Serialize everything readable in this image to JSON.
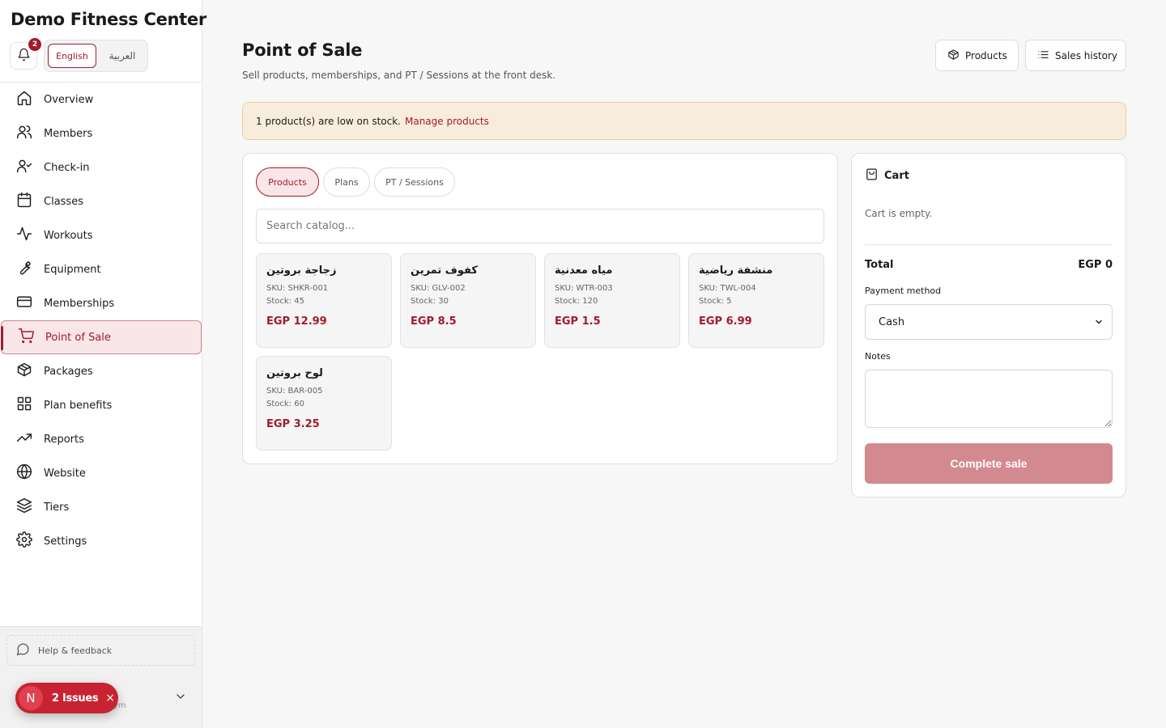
{
  "app": {
    "title": "Demo Fitness Center"
  },
  "notifications": {
    "count": "2"
  },
  "language": {
    "english": "English",
    "arabic": "العربية"
  },
  "sidebar": {
    "items": [
      {
        "label": "Overview",
        "icon": "home-icon"
      },
      {
        "label": "Members",
        "icon": "users-icon"
      },
      {
        "label": "Check-in",
        "icon": "user-check-icon"
      },
      {
        "label": "Classes",
        "icon": "calendar-icon"
      },
      {
        "label": "Workouts",
        "icon": "activity-icon"
      },
      {
        "label": "Equipment",
        "icon": "wrench-icon"
      },
      {
        "label": "Memberships",
        "icon": "credit-card-icon"
      },
      {
        "label": "Point of Sale",
        "icon": "cart-icon",
        "active": true
      },
      {
        "label": "Packages",
        "icon": "package-icon"
      },
      {
        "label": "Plan benefits",
        "icon": "grid-icon"
      },
      {
        "label": "Reports",
        "icon": "trending-up-icon"
      },
      {
        "label": "Website",
        "icon": "globe-icon"
      },
      {
        "label": "Tiers",
        "icon": "layers-icon"
      },
      {
        "label": "Settings",
        "icon": "gear-icon"
      }
    ],
    "help_label": "Help & feedback",
    "account_hint": "ym"
  },
  "issues_badge": {
    "letter": "N",
    "label": "2 Issues",
    "close": "×"
  },
  "header": {
    "title": "Point of Sale",
    "subtitle": "Sell products, memberships, and PT / Sessions at the front desk.",
    "products_button": "Products",
    "history_button": "Sales history"
  },
  "alert": {
    "text": "1 product(s) are low on stock.",
    "link": "Manage products"
  },
  "catalog": {
    "tabs": [
      {
        "label": "Products",
        "active": true
      },
      {
        "label": "Plans"
      },
      {
        "label": "PT / Sessions"
      }
    ],
    "search_placeholder": "Search catalog...",
    "products": [
      {
        "name": "زجاجة بروتين",
        "sku": "SKU: SHKR-001",
        "stock": "Stock: 45",
        "price": "EGP 12.99"
      },
      {
        "name": "كفوف تمرين",
        "sku": "SKU: GLV-002",
        "stock": "Stock: 30",
        "price": "EGP 8.5"
      },
      {
        "name": "مياه معدنية",
        "sku": "SKU: WTR-003",
        "stock": "Stock: 120",
        "price": "EGP 1.5"
      },
      {
        "name": "منشفة رياضية",
        "sku": "SKU: TWL-004",
        "stock": "Stock: 5",
        "price": "EGP 6.99"
      },
      {
        "name": "لوح بروتين",
        "sku": "SKU: BAR-005",
        "stock": "Stock: 60",
        "price": "EGP 3.25"
      }
    ]
  },
  "cart": {
    "title": "Cart",
    "empty_text": "Cart is empty.",
    "total_label": "Total",
    "total_value": "EGP 0",
    "payment_label": "Payment method",
    "payment_value": "Cash",
    "notes_label": "Notes",
    "complete_label": "Complete sale"
  },
  "colors": {
    "accent": "#a31a2c",
    "accent_soft": "#f9e6e8",
    "alert_bg": "#f8eddd",
    "disabled_button": "#d28a90"
  }
}
